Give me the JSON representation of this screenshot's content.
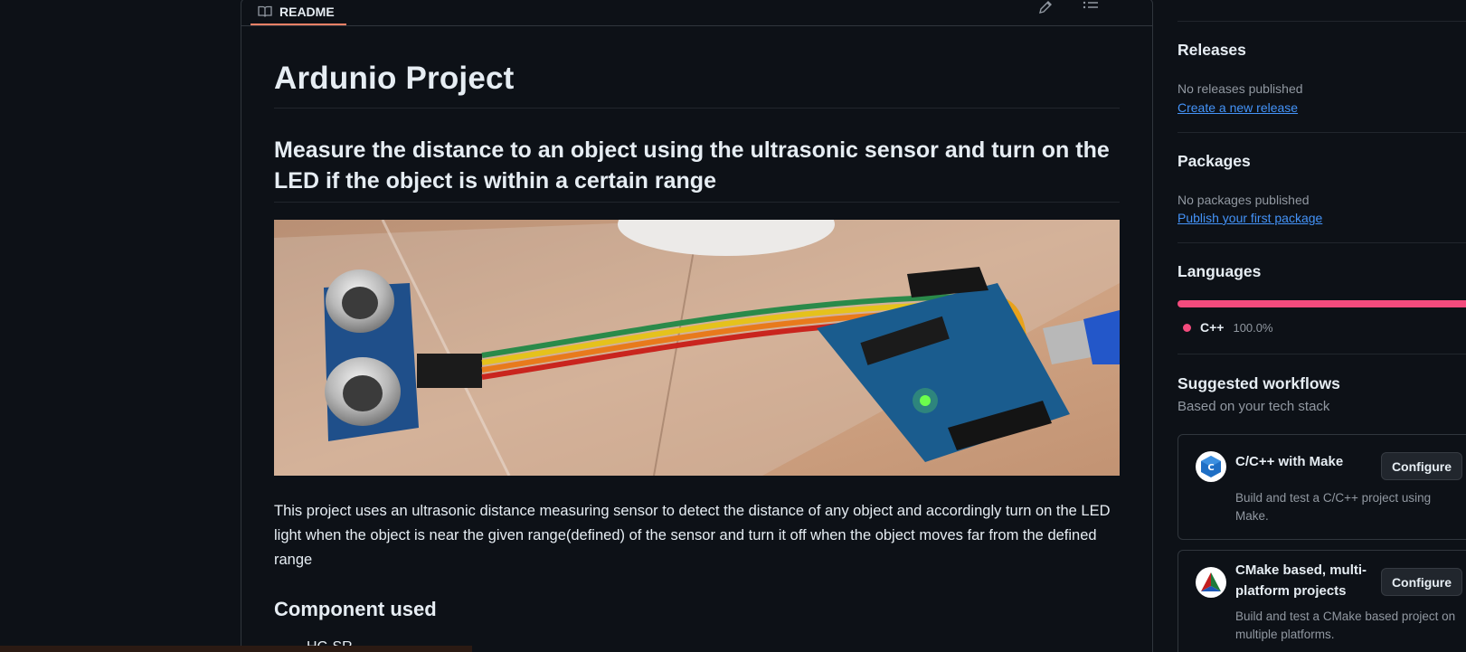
{
  "readme": {
    "tab_label": "README",
    "title": "Ardunio Project",
    "subtitle": "Measure the distance to an object using the ultrasonic sensor and turn on the LED if the object is within a certain range",
    "description": "This project uses an ultrasonic distance measuring sensor to detect the distance of any object and accordingly turn on the LED light when the object is near the given range(defined) of the sensor and turn it off when the object moves far from the defined range",
    "section_heading": "Component used",
    "list_peek": "HC-SR"
  },
  "sidebar": {
    "releases": {
      "title": "Releases",
      "status": "No releases published",
      "link": "Create a new release"
    },
    "packages": {
      "title": "Packages",
      "status": "No packages published",
      "link": "Publish your first package"
    },
    "languages": {
      "title": "Languages",
      "items": [
        {
          "name": "C++",
          "percent": "100.0%",
          "color": "#f34b7d"
        }
      ]
    },
    "workflows": {
      "title": "Suggested workflows",
      "subtitle": "Based on your tech stack",
      "items": [
        {
          "title": "C/C++ with Make",
          "description_line1": "Build and test a C/C++ project using",
          "description_line2": "Make.",
          "button": "Configure",
          "icon": "cpp-icon"
        },
        {
          "title_line1": "CMake based, multi-",
          "title_line2": "platform projects",
          "description_line1": "Build and test a CMake based project on",
          "description_line2": "multiple platforms.",
          "button": "Configure",
          "icon": "cmake-icon"
        }
      ]
    }
  },
  "colors": {
    "background": "#0d1117",
    "border": "#30363d",
    "text": "#e6edf3",
    "muted": "#9198a1",
    "link": "#4493f8",
    "tab_accent": "#f78166",
    "cpp": "#f34b7d"
  }
}
